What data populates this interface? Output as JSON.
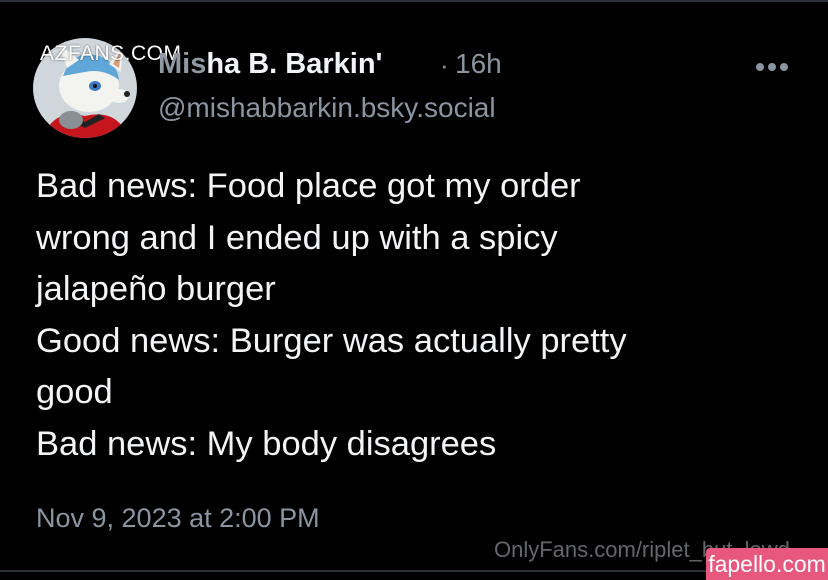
{
  "post": {
    "author": {
      "display_name_prefix": "Mis",
      "display_name_rest": "ha B. Barkin'",
      "handle": "@mishabbarkin.bsky.social",
      "avatar": "furry-fox-avatar"
    },
    "separator": "·",
    "relative_time": "16h",
    "more_icon": "more-horizontal-icon",
    "body_lines": [
      "Bad news: Food place got my order",
      "wrong and I ended up with a spicy",
      "jalapeño burger",
      "Good news: Burger was actually pretty",
      "good",
      "Bad news: My body disagrees"
    ],
    "date": "Nov 9, 2023 at 2:00 PM"
  },
  "watermarks": {
    "azfans": "AZFANS.COM",
    "onlyfans": "OnlyFans.com/riplet_but_lewd",
    "fapello": "fapello.com"
  },
  "colors": {
    "background": "#000000",
    "text_primary": "#f3f4f6",
    "text_secondary": "#8b95a1",
    "fapello_badge": "#e8577d"
  }
}
